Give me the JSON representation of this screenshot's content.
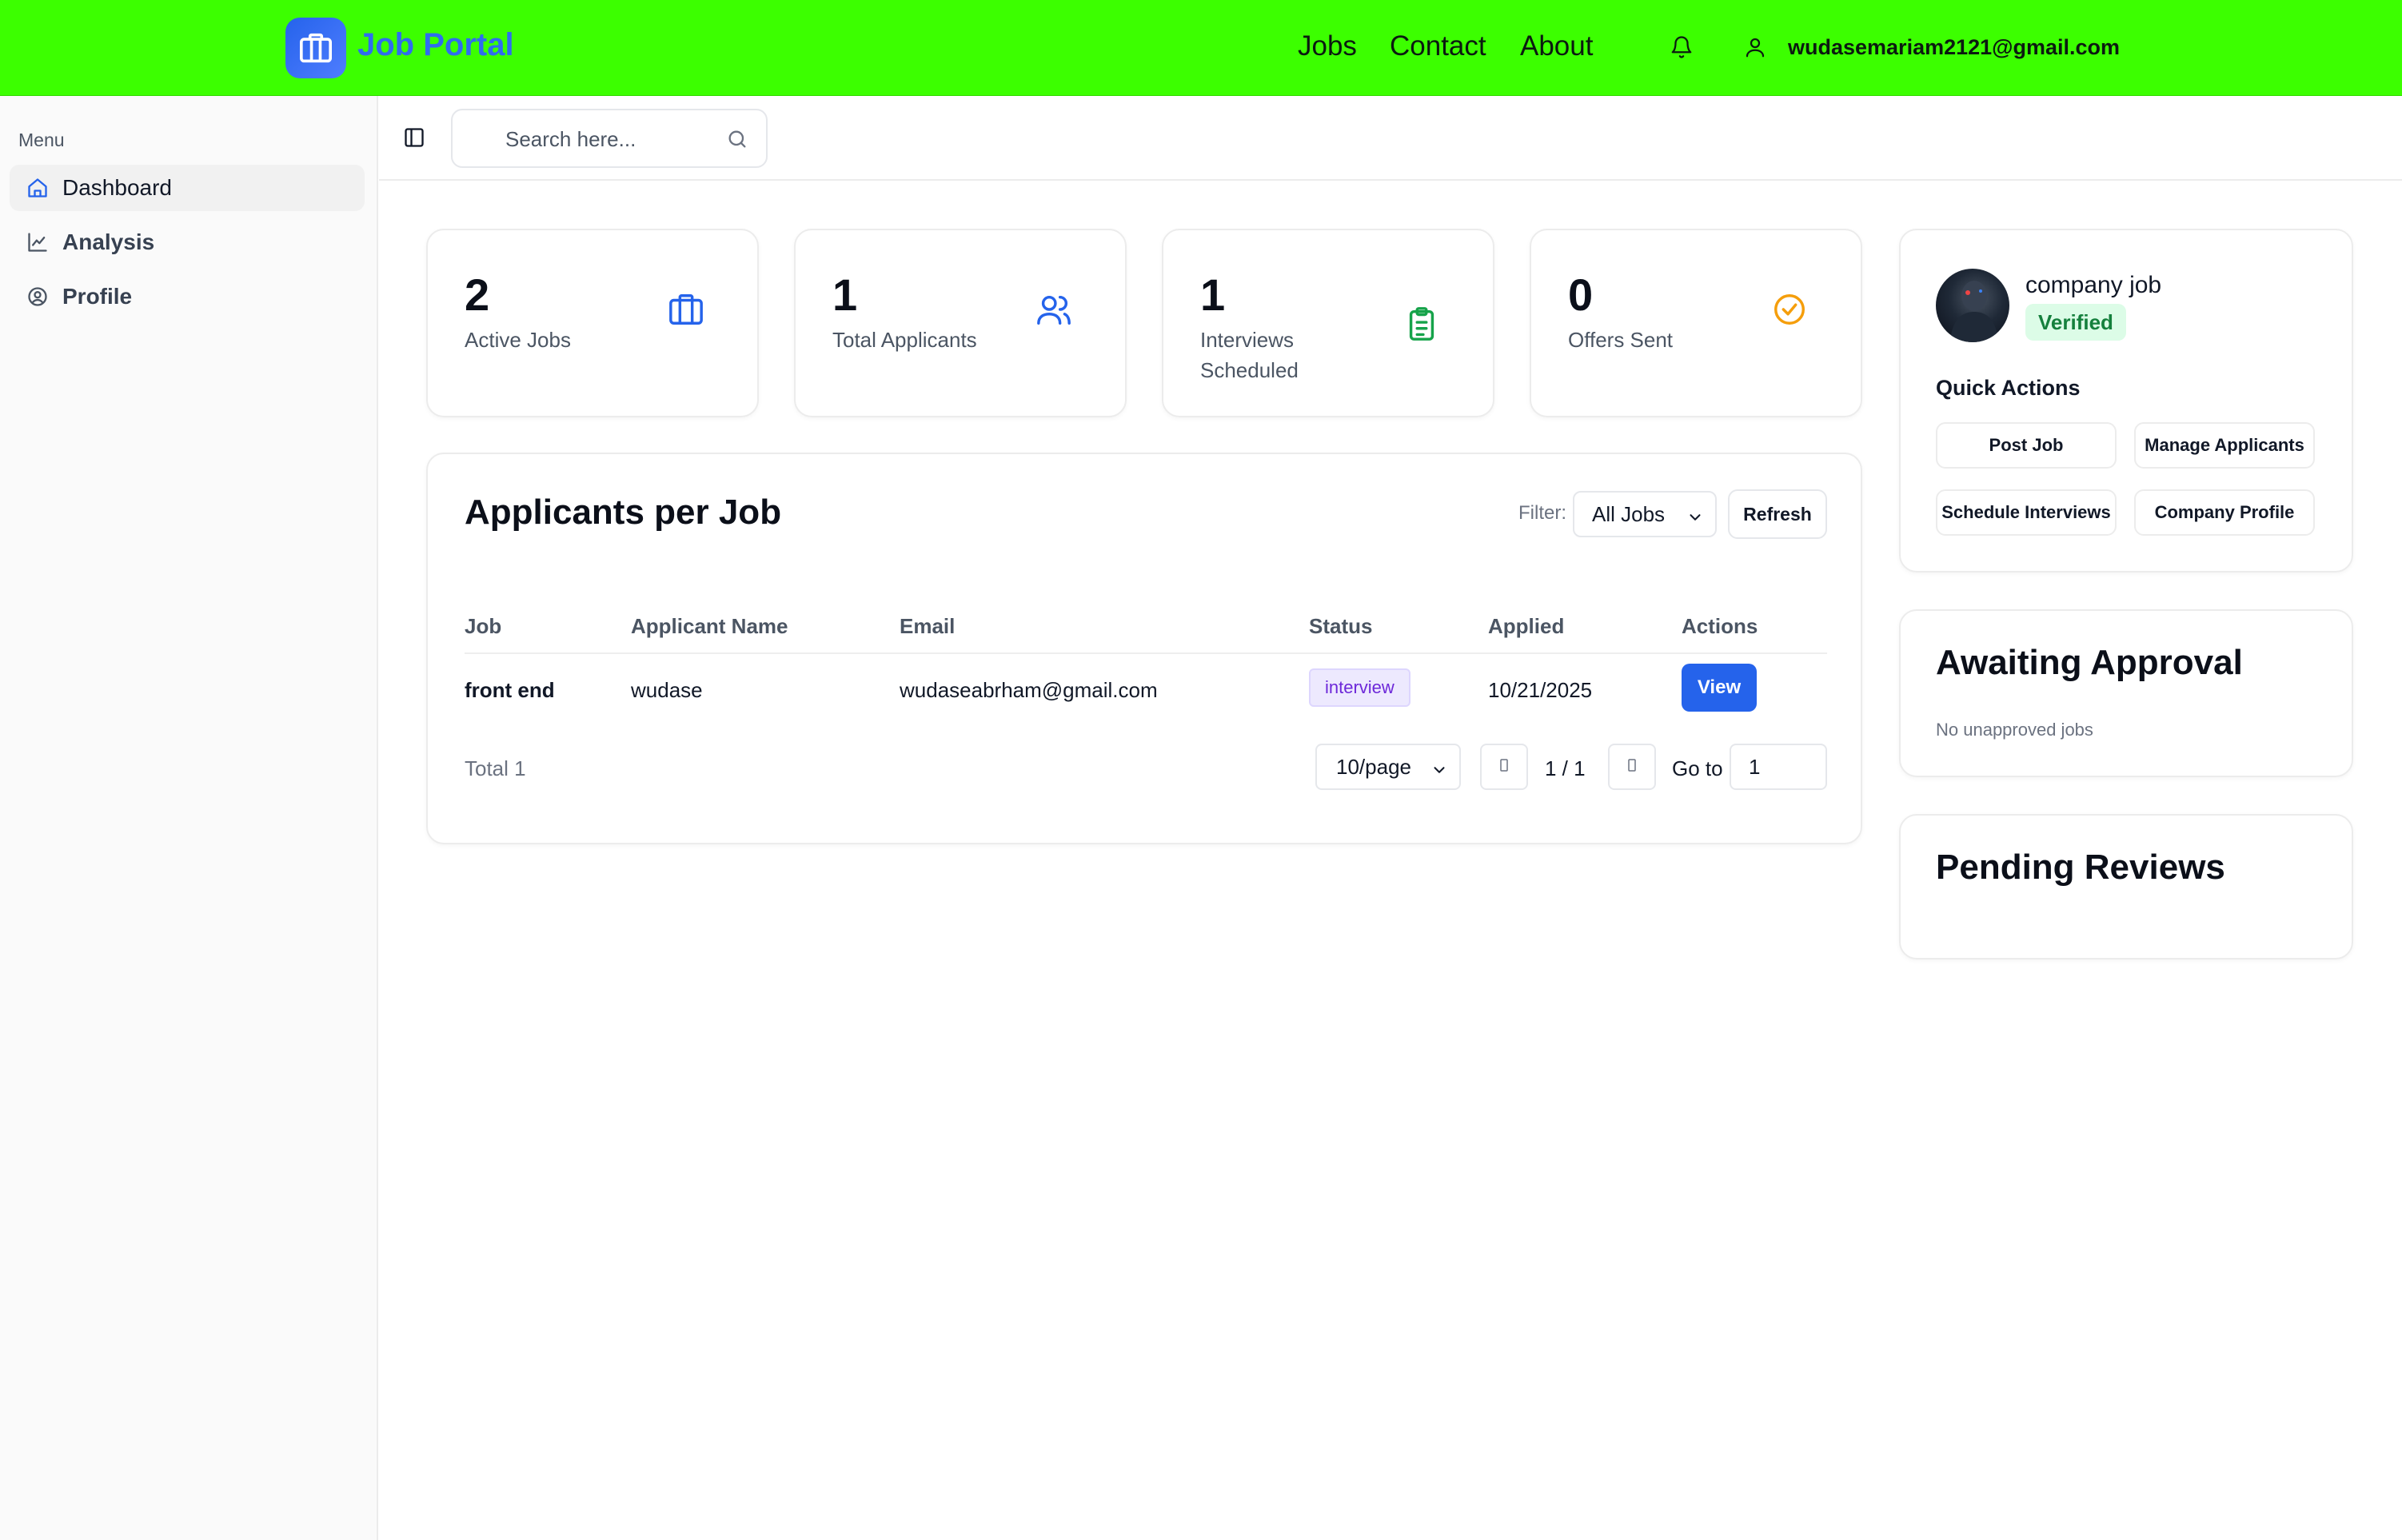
{
  "header": {
    "brand": "Job Portal",
    "nav": [
      "Jobs",
      "Contact",
      "About"
    ],
    "user_email": "wudasemariam2121@gmail.com"
  },
  "sidebar": {
    "menu_label": "Menu",
    "items": [
      {
        "label": "Dashboard",
        "icon": "home-icon",
        "active": true
      },
      {
        "label": "Analysis",
        "icon": "chart-line-icon",
        "active": false
      },
      {
        "label": "Profile",
        "icon": "user-circle-icon",
        "active": false
      }
    ]
  },
  "search": {
    "placeholder": "Search here..."
  },
  "stats": [
    {
      "value": "2",
      "label": "Active Jobs",
      "icon": "briefcase-icon",
      "color": "#2563eb"
    },
    {
      "value": "1",
      "label": "Total Applicants",
      "icon": "users-icon",
      "color": "#2563eb"
    },
    {
      "value": "1",
      "label": "Interviews Scheduled",
      "icon": "clipboard-icon",
      "color": "#16a34a"
    },
    {
      "value": "0",
      "label": "Offers Sent",
      "icon": "check-circle-icon",
      "color": "#f59e0b"
    }
  ],
  "applicants": {
    "title": "Applicants per Job",
    "filter_label": "Filter:",
    "filter_value": "All Jobs",
    "refresh_label": "Refresh",
    "columns": [
      "Job",
      "Applicant Name",
      "Email",
      "Status",
      "Applied",
      "Actions"
    ],
    "rows": [
      {
        "job": "front end",
        "name": "wudase",
        "email": "wudaseabrham@gmail.com",
        "status": "interview",
        "applied": "10/21/2025",
        "action": "View"
      }
    ],
    "total": "Total 1",
    "per_page": "10/page",
    "page_info": "1 / 1",
    "goto_label": "Go to",
    "goto_value": "1"
  },
  "company": {
    "name": "company job",
    "verified_label": "Verified",
    "quick_actions_label": "Quick Actions",
    "actions": [
      "Post Job",
      "Manage Applicants",
      "Schedule Interviews",
      "Company Profile"
    ]
  },
  "awaiting": {
    "title": "Awaiting Approval",
    "empty": "No unapproved jobs"
  },
  "pending": {
    "title": "Pending Reviews"
  },
  "colors": {
    "header_bg": "#3cff00",
    "brand": "#2f6cf0",
    "primary": "#2563eb"
  }
}
